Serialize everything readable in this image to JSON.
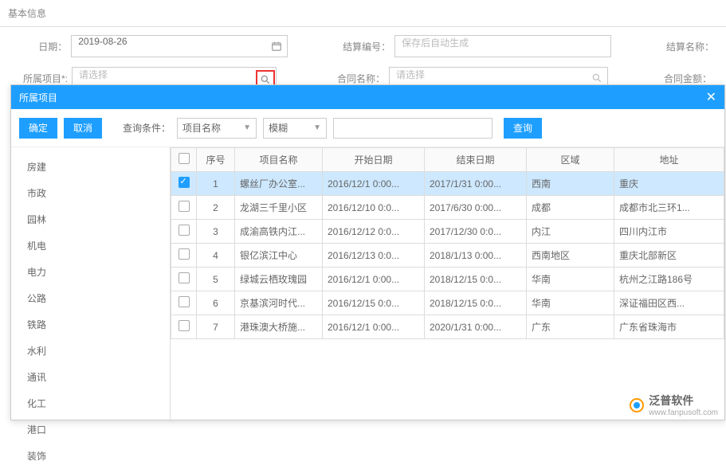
{
  "header": {
    "title": "基本信息"
  },
  "form": {
    "date_label": "日期：",
    "date_value": "2019-08-26",
    "settle_no_label": "结算编号：",
    "settle_no_placeholder": "保存后自动生成",
    "settle_name_label": "结算名称：",
    "project_label": "所属项目*:",
    "project_placeholder": "请选择",
    "contract_name_label": "合同名称：",
    "contract_name_placeholder": "请选择",
    "contract_amount_label": "合同金额："
  },
  "modal": {
    "title": "所属项目",
    "confirm": "确定",
    "cancel": "取消",
    "cond_label": "查询条件：",
    "select1": "项目名称",
    "select2": "模糊",
    "query": "查询",
    "close": "✕"
  },
  "sidebar": {
    "items": [
      "房建",
      "市政",
      "园林",
      "机电",
      "电力",
      "公路",
      "铁路",
      "水利",
      "通讯",
      "化工",
      "港口",
      "装饰"
    ]
  },
  "grid": {
    "headers": {
      "idx": "序号",
      "name": "项目名称",
      "start": "开始日期",
      "end": "结束日期",
      "region": "区域",
      "addr": "地址"
    },
    "rows": [
      {
        "idx": "1",
        "name": "螺丝厂办公室...",
        "start": "2016/12/1 0:00...",
        "end": "2017/1/31 0:00...",
        "region": "西南",
        "addr": "重庆",
        "selected": true
      },
      {
        "idx": "2",
        "name": "龙湖三千里小区",
        "start": "2016/12/10 0:0...",
        "end": "2017/6/30 0:00...",
        "region": "成都",
        "addr": "成都市北三环1..."
      },
      {
        "idx": "3",
        "name": "成渝高铁内江...",
        "start": "2016/12/12 0:0...",
        "end": "2017/12/30 0:0...",
        "region": "内江",
        "addr": "四川内江市"
      },
      {
        "idx": "4",
        "name": "银亿滨江中心",
        "start": "2016/12/13 0:0...",
        "end": "2018/1/13 0:00...",
        "region": "西南地区",
        "addr": "重庆北部新区"
      },
      {
        "idx": "5",
        "name": "绿城云栖玫瑰园",
        "start": "2016/12/1 0:00...",
        "end": "2018/12/15 0:0...",
        "region": "华南",
        "addr": "杭州之江路186号"
      },
      {
        "idx": "6",
        "name": "京基滨河时代...",
        "start": "2016/12/15 0:0...",
        "end": "2018/12/15 0:0...",
        "region": "华南",
        "addr": "深证福田区西..."
      },
      {
        "idx": "7",
        "name": "港珠澳大桥施...",
        "start": "2016/12/1 0:00...",
        "end": "2020/1/31 0:00...",
        "region": "广东",
        "addr": "广东省珠海市"
      }
    ]
  },
  "watermark": {
    "name": "泛普软件",
    "url": "www.fanpusoft.com"
  }
}
